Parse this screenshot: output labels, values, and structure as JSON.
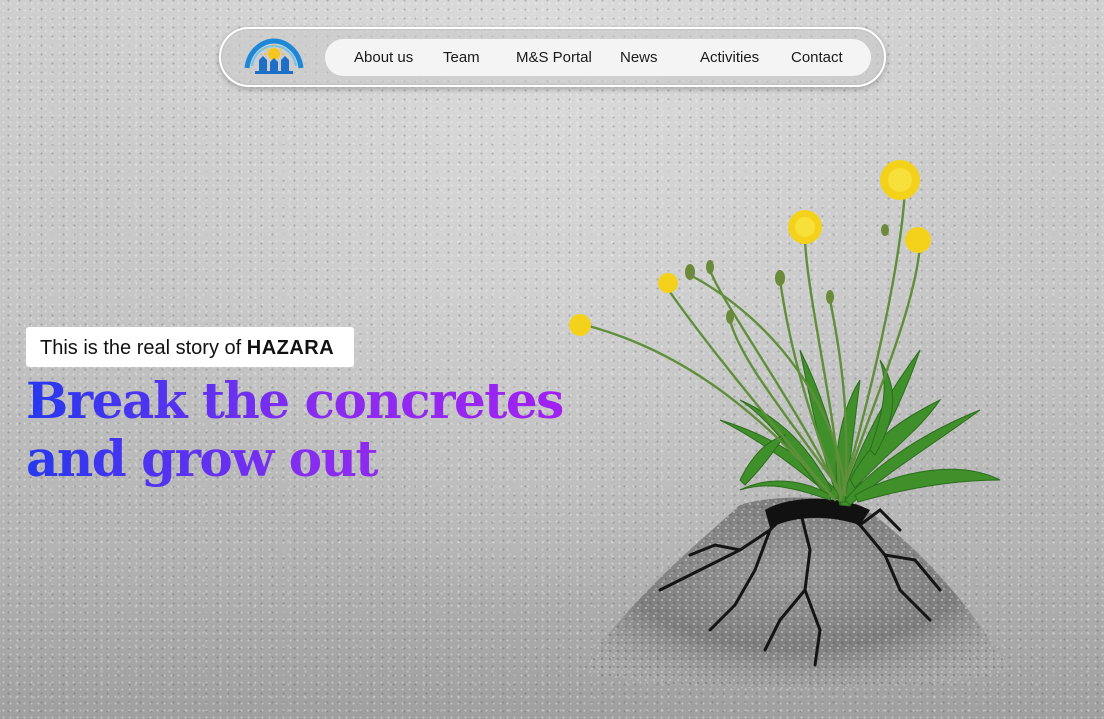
{
  "nav": {
    "logo_icon": "organization-logo",
    "items": [
      {
        "label": "About us"
      },
      {
        "label": "Team"
      },
      {
        "label": "M&S Portal"
      },
      {
        "label": "News"
      },
      {
        "label": "Activities"
      },
      {
        "label": "Contact"
      }
    ]
  },
  "hero": {
    "tag_prefix": "This is the real story of ",
    "tag_highlight": "HAZARA",
    "headline_line1": "Break the concretes",
    "headline_line2": "and grow out",
    "image": "dandelion-breaking-asphalt",
    "gradient_start": "#2638ef",
    "gradient_end": "#a021f2"
  }
}
